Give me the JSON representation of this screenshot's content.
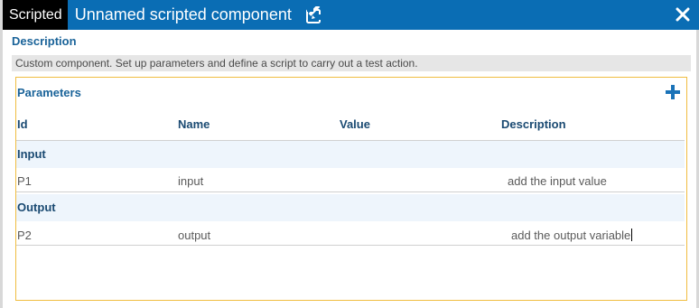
{
  "titlebar": {
    "tag": "Scripted",
    "title": "Unnamed scripted component",
    "edit_icon": "edit-icon",
    "close_icon": "close-icon"
  },
  "description": {
    "heading": "Description",
    "text": "Custom component. Set up parameters and define a script to carry out a test action."
  },
  "parameters": {
    "title": "Parameters",
    "add_icon": "plus-icon",
    "columns": [
      "Id",
      "Name",
      "Value",
      "Description"
    ],
    "groups": [
      {
        "label": "Input",
        "rows": [
          {
            "id": "P1",
            "name": "input",
            "value": "",
            "description": "add the input value"
          }
        ]
      },
      {
        "label": "Output",
        "rows": [
          {
            "id": "P2",
            "name": "output",
            "value": "",
            "description": "add the output variable"
          }
        ]
      }
    ]
  },
  "colors": {
    "titlebar": "#0a6db4",
    "accent_text": "#1a6399",
    "panel_border": "#f0bd40",
    "group_bg": "#eef5fc"
  }
}
